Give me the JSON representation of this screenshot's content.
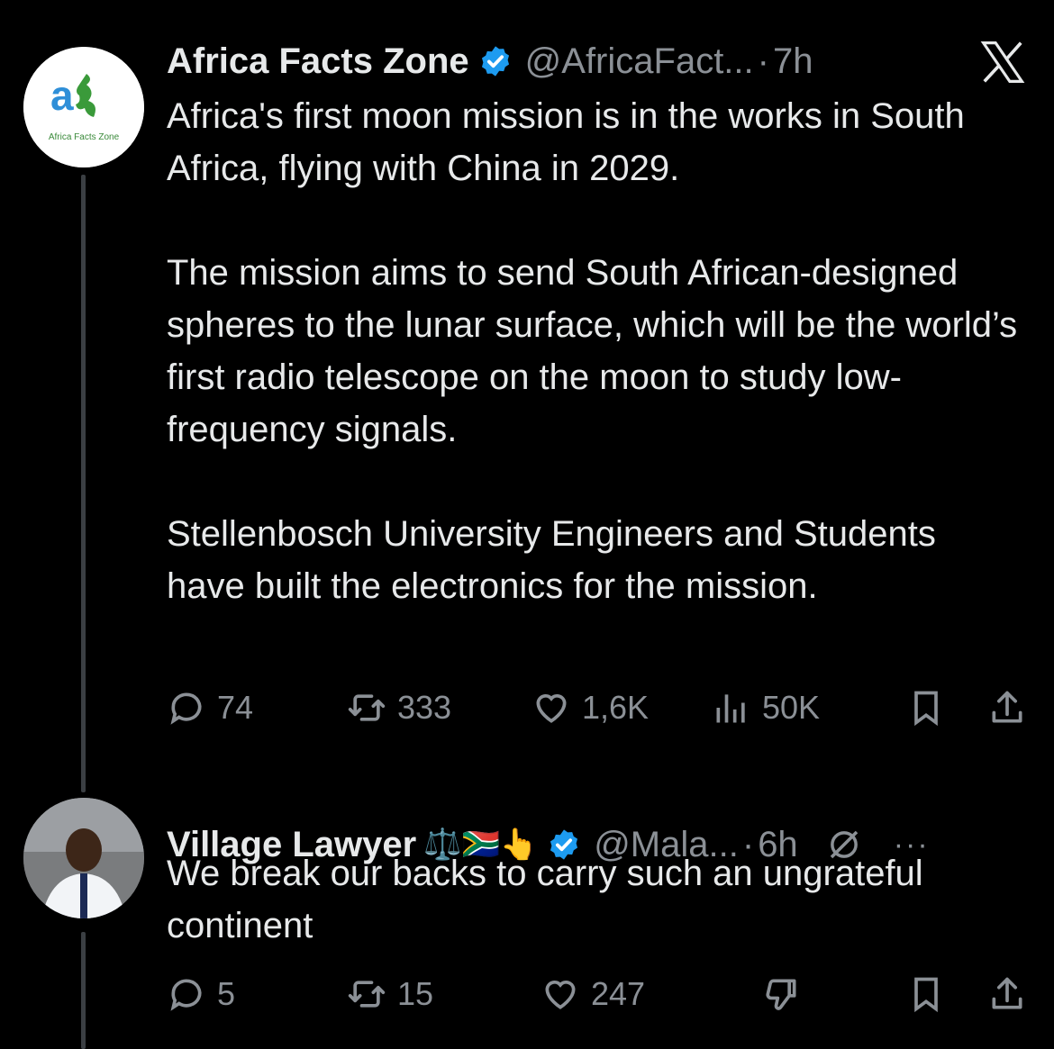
{
  "tweet1": {
    "name": "Africa Facts Zone",
    "handle": "@AfricaFact...",
    "separator": "·",
    "time": "7h",
    "avatar_text": "Africa Facts Zone",
    "paragraphs": [
      "Africa's first moon mission is in the works in South Africa, flying with China in 2029.",
      "The mission aims to send South African-designed spheres to the lunar surface, which will be the world’s first radio telescope on the moon to study low-frequency signals.",
      "Stellenbosch University Engineers and Students have built the electronics for the mission."
    ],
    "replies": "74",
    "reposts": "333",
    "likes": "1,6K",
    "views": "50K"
  },
  "tweet2": {
    "name": "Village Lawyer",
    "name_emojis": "⚖️🇿🇦👆",
    "handle": "@Mala...",
    "separator": "·",
    "time": "6h",
    "more": "···",
    "paragraphs": [
      "We break our backs to carry such an ungrateful continent"
    ],
    "replies": "5",
    "reposts": "15",
    "likes": "247"
  },
  "colors": {
    "background": "#000000",
    "text": "#e7e9ea",
    "muted": "#8b9096",
    "verified": "#1d9bf0",
    "thread_line": "#3b3f43"
  },
  "icons": {
    "reply": "reply-icon",
    "repost": "repost-icon",
    "like": "heart-icon",
    "views": "views-icon",
    "bookmark": "bookmark-icon",
    "share": "share-icon",
    "dislike": "dislike-icon",
    "grok": "grok-icon",
    "x_logo": "x-logo-icon"
  }
}
